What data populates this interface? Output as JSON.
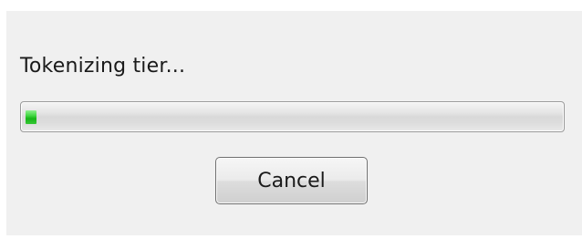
{
  "dialog": {
    "status_text": "Tokenizing tier...",
    "progress": {
      "value_percent": 2,
      "fill_color": "#22bb22"
    },
    "cancel_label": "Cancel"
  }
}
